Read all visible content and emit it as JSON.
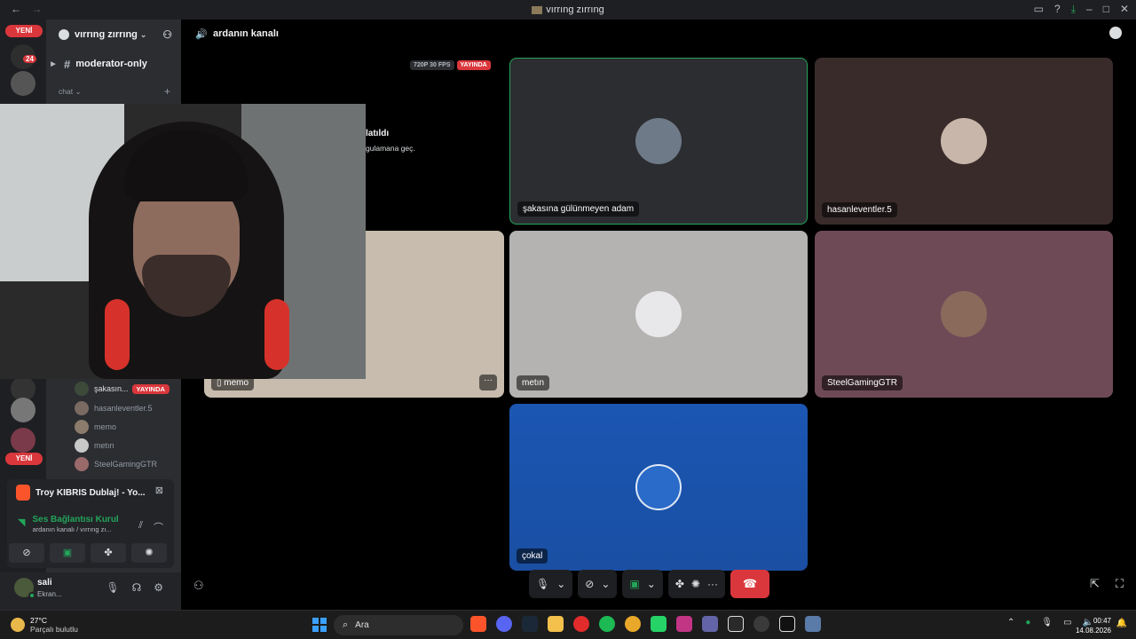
{
  "window": {
    "title": "vırrıng zırrıng"
  },
  "nav": {
    "back": "←",
    "forward": "→"
  },
  "servers": {
    "new_label_top": "YENİ",
    "new_label_bottom": "YENİ",
    "notif_count": "24"
  },
  "sidebar": {
    "guild_name": "vırrıng zırrıng",
    "channels": [
      {
        "name": "moderator-only"
      }
    ],
    "category": "chat",
    "voice_users": [
      {
        "name": "şakasın...",
        "live": "YAYINDA"
      },
      {
        "name": "hasanleventler.5"
      },
      {
        "name": "memo"
      },
      {
        "name": "metın"
      },
      {
        "name": "SteelGamingGTR"
      }
    ]
  },
  "activity": {
    "app": "Troy KIBRIS Dublaj! - Yo...",
    "connection": "Ses Bağlantısı Kurul",
    "location": "ardanın kanalı / vırrıng zı..."
  },
  "user": {
    "name": "sali",
    "status": "Ekran..."
  },
  "voice_header": {
    "channel": "ardanın kanalı"
  },
  "stream": {
    "quality": "720P 30 FPS",
    "live": "YAYINDA",
    "partial_title": "latıldı",
    "partial_sub": "gulamana geç."
  },
  "tiles": [
    {
      "name": "şakasına gülünmeyen adam",
      "color": "#2b2d31"
    },
    {
      "name": "hasanleventler.5",
      "color": "#3a2b2b"
    },
    {
      "name": "memo",
      "color": "#c7bcae"
    },
    {
      "name": "metın",
      "color": "#b5b3b2"
    },
    {
      "name": "SteelGamingGTR",
      "color": "#6e4a57"
    },
    {
      "name": "çokal",
      "color": "#1b56b3"
    }
  ],
  "taskbar": {
    "temp": "27°C",
    "weather": "Parçalı bulutlu",
    "search": "Ara",
    "time": "00:47",
    "date": "14.08.2026"
  }
}
